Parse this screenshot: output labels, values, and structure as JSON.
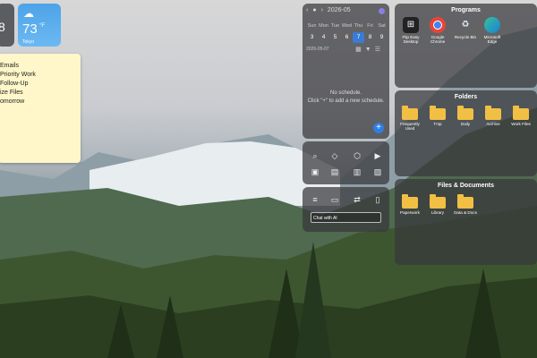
{
  "weather": {
    "temp": "73",
    "unit": "°F",
    "city": "Tokyo"
  },
  "left_widget": {
    "value": "8"
  },
  "sticky_note": {
    "lines": [
      "Emails",
      "Priority Work",
      "Follow-Up",
      "ize Files",
      "omorrow"
    ]
  },
  "calendar": {
    "month": "2026-05",
    "weekdays": [
      "Sun",
      "Mon",
      "Tue",
      "Wed",
      "Thu",
      "Fri",
      "Sat"
    ],
    "dates": [
      "3",
      "4",
      "5",
      "6",
      "7",
      "8",
      "9"
    ],
    "selected_index": 4,
    "selected_date": "2026-05-07",
    "empty_title": "No schedule.",
    "empty_hint": "Click \"+\" to add a new schedule.",
    "add_label": "+"
  },
  "chat": {
    "placeholder": "Chat with AI"
  },
  "programs": {
    "title": "Programs",
    "apps": [
      {
        "label": "Flip Easy Desktop",
        "icon": "flip-icon",
        "color": "#222222"
      },
      {
        "label": "Google Chrome",
        "icon": "chrome-icon",
        "color": "#ffffff"
      },
      {
        "label": "Recycle Bin",
        "icon": "recycle-bin-icon",
        "color": "#dfe9f5"
      },
      {
        "label": "Microsoft Edge",
        "icon": "edge-icon",
        "color": "#1fa8d8"
      }
    ]
  },
  "folders": {
    "title": "Folders",
    "items": [
      "Frequently Used",
      "Tmp",
      "Daily",
      "Archive",
      "Work Files"
    ]
  },
  "files": {
    "title": "Files & Documents",
    "items": [
      "Paperwork",
      "Library",
      "Data & Docs"
    ]
  },
  "colors": {
    "accent": "#3a7bd5",
    "folder": "#f2bf45",
    "weather": "#5aafef"
  }
}
